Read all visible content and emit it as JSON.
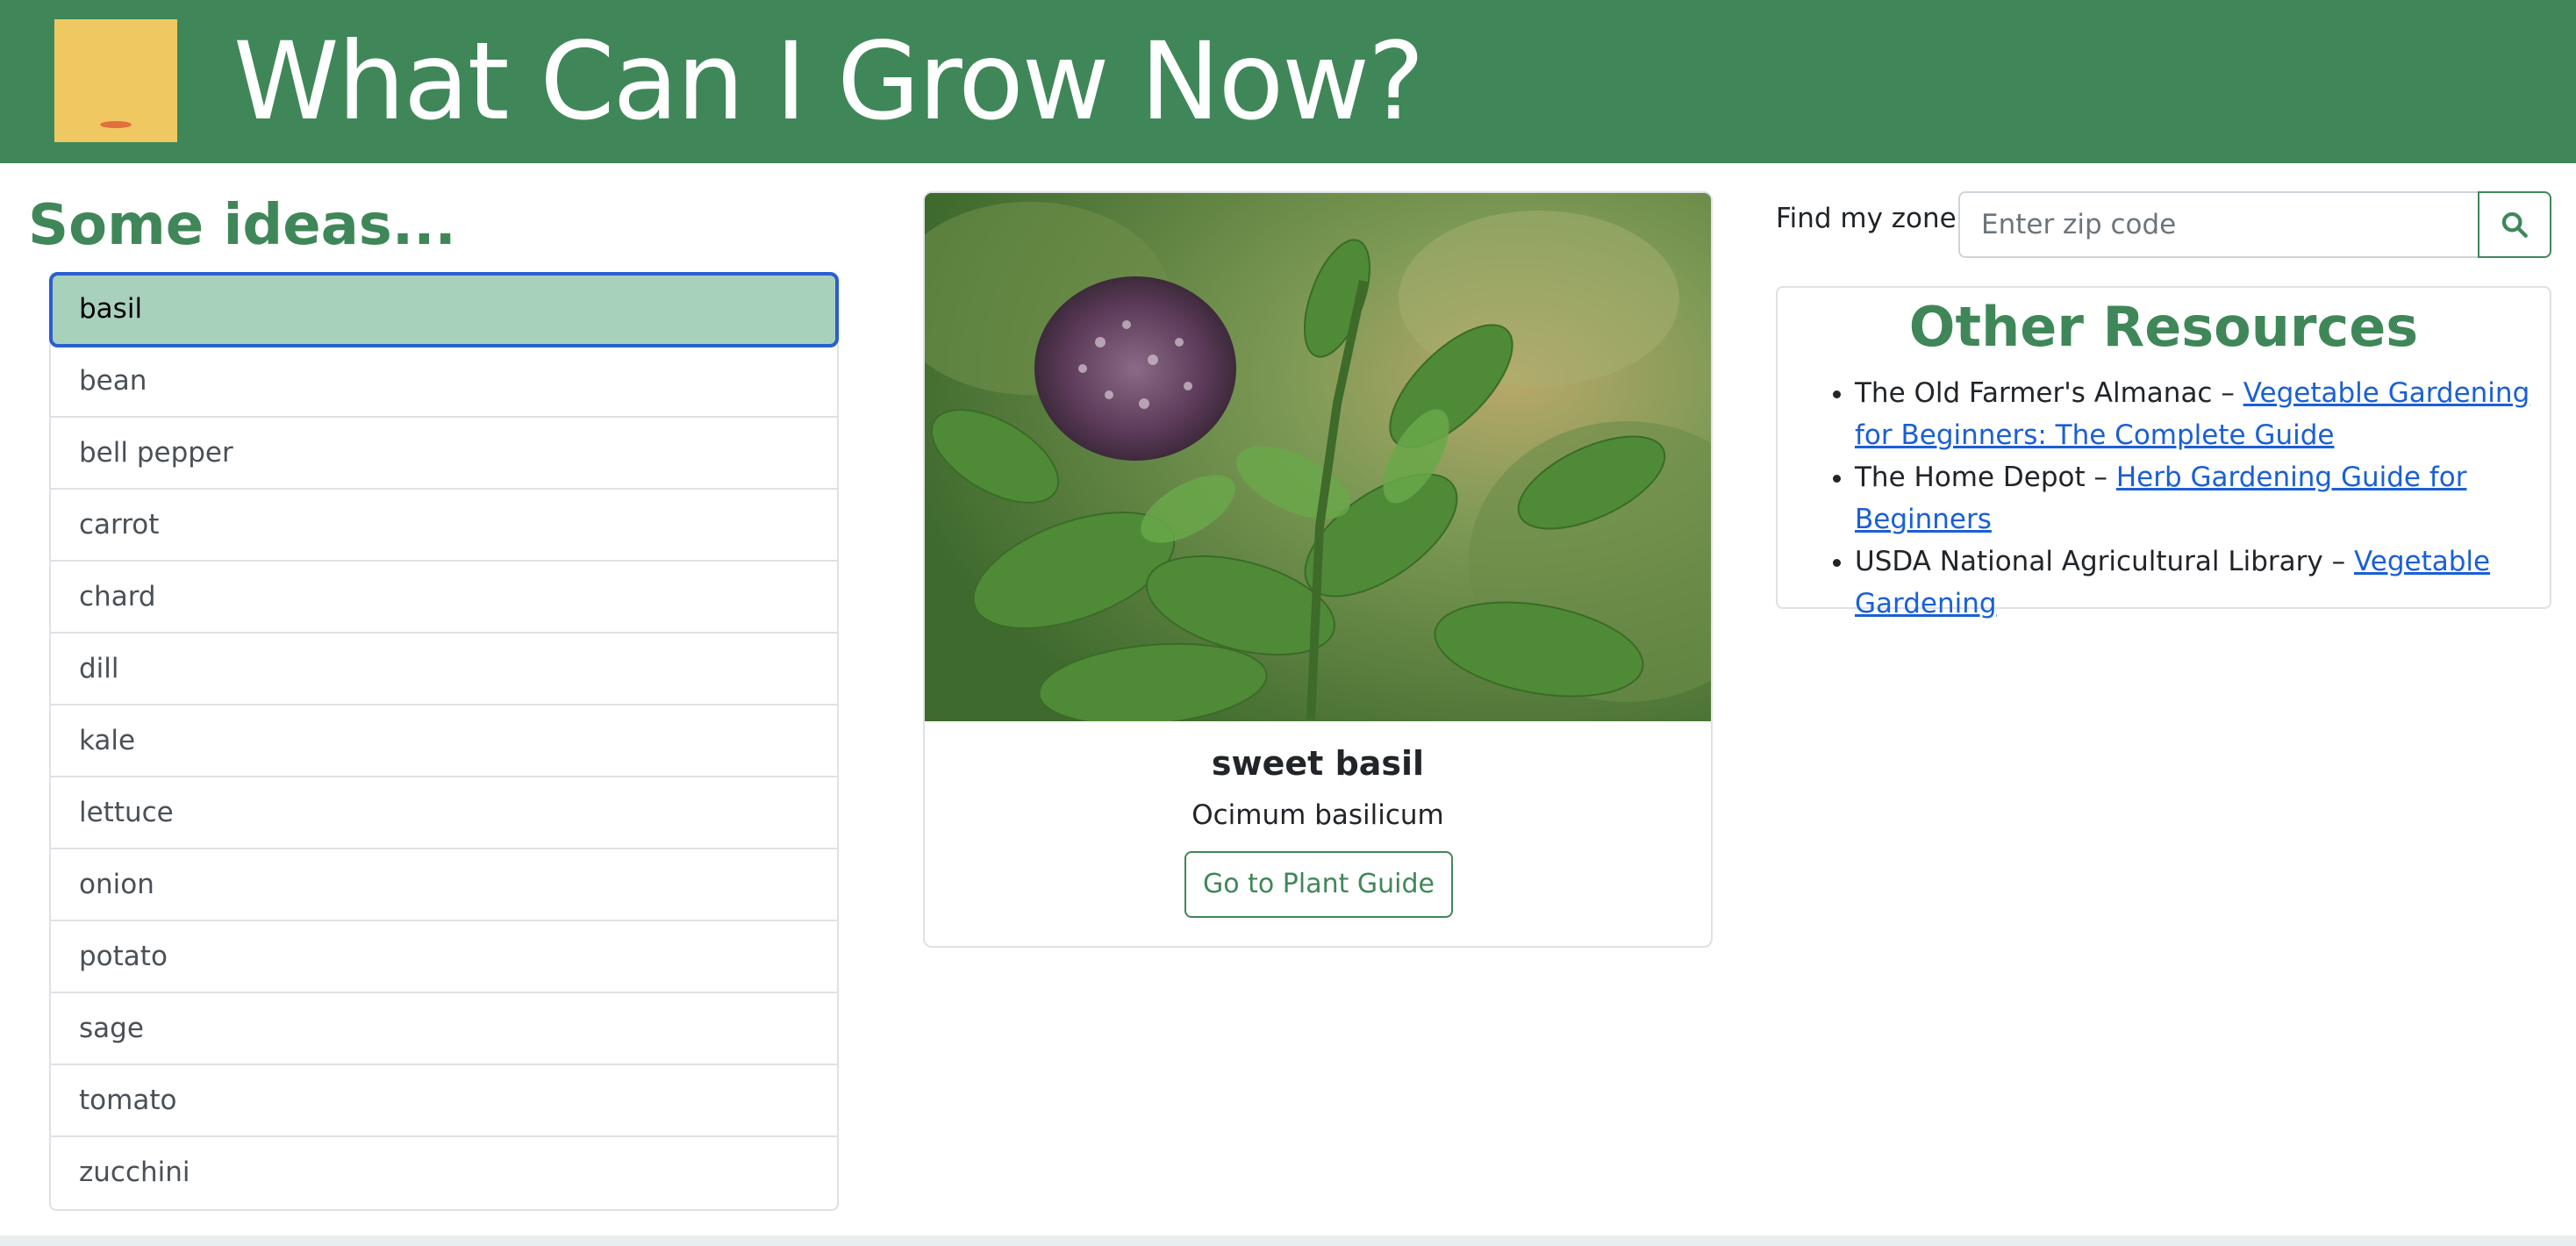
{
  "header": {
    "title": "What Can I Grow Now?",
    "logo_icon": "sun-over-soil-logo-icon",
    "bg_color": "#3f8758"
  },
  "ideas": {
    "heading": "Some ideas...",
    "selected": "basil",
    "items": [
      "basil",
      "bean",
      "bell pepper",
      "carrot",
      "chard",
      "dill",
      "kale",
      "lettuce",
      "onion",
      "potato",
      "sage",
      "tomato",
      "zucchini"
    ]
  },
  "plant_card": {
    "image": "basil-plant-photo",
    "common_name": "sweet basil",
    "latin_name": "Ocimum basilicum",
    "button_label": "Go to Plant Guide"
  },
  "zone_finder": {
    "label": "Find my zone:",
    "placeholder": "Enter zip code",
    "value": "",
    "search_icon": "search-icon"
  },
  "resources": {
    "title": "Other Resources",
    "items": [
      {
        "source": "The Old Farmer's Almanac – ",
        "link": "Vegetable Gardening for Beginners: The Complete Guide"
      },
      {
        "source": "The Home Depot – ",
        "link": "Herb Gardening Guide for Beginners"
      },
      {
        "source": "USDA National Agricultural Library – ",
        "link": "Vegetable Gardening"
      }
    ]
  },
  "colors": {
    "accent_green": "#3f8758",
    "selected_item_bg": "#a8d1bc",
    "selected_item_border": "#2a5fcf",
    "link": "#1a5fd6",
    "logo_yellow": "#f0c862"
  }
}
